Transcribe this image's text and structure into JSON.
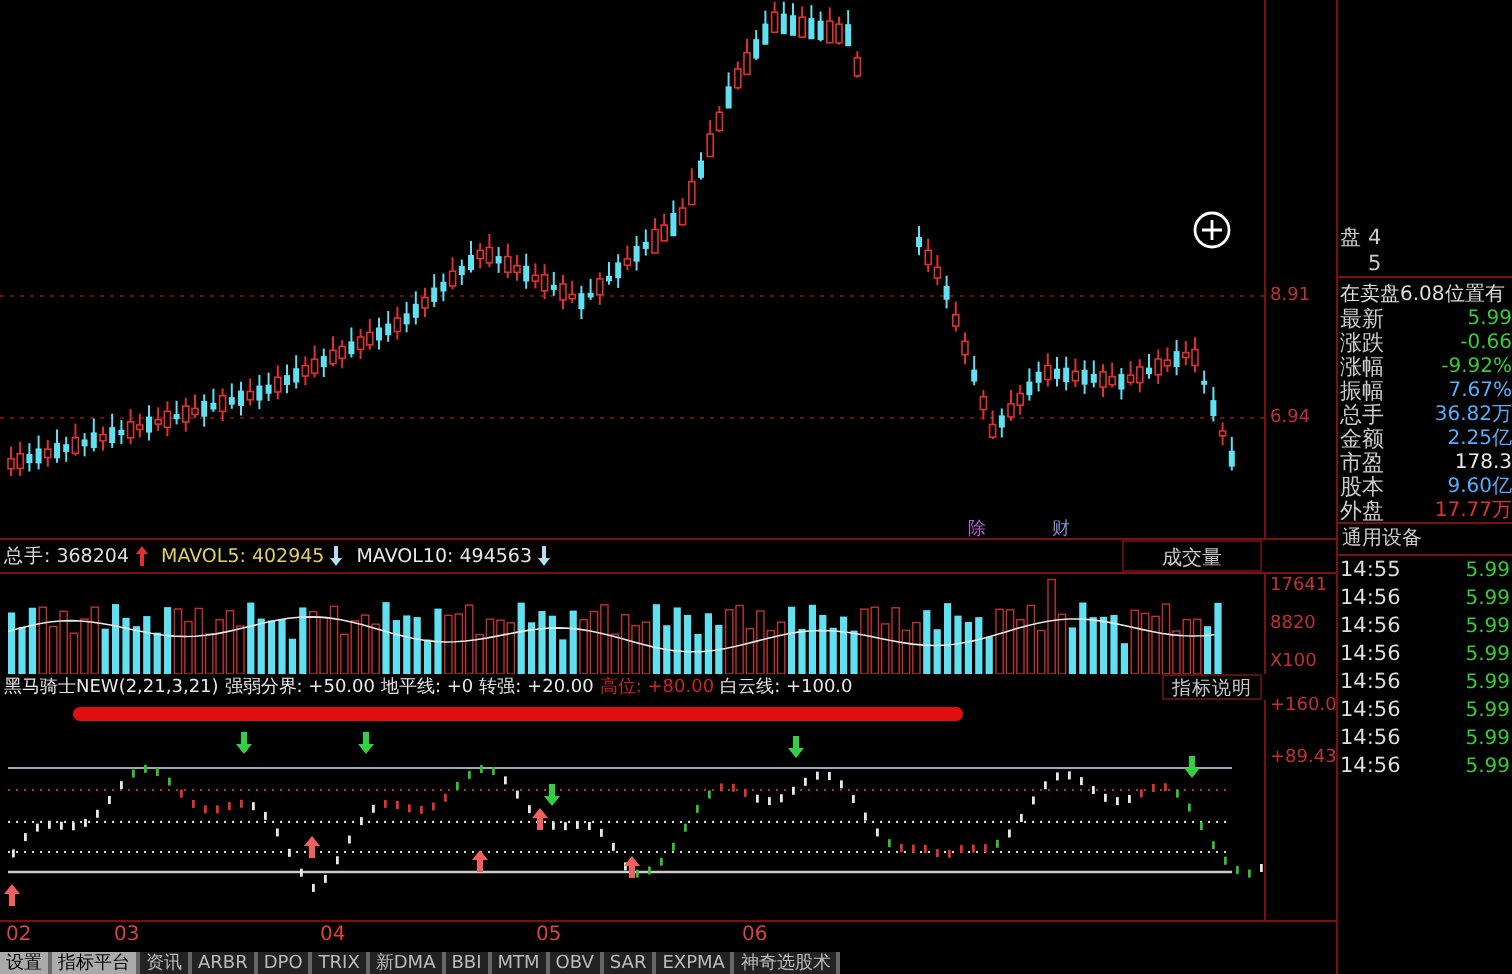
{
  "main_chart": {
    "axis_labels": [
      "8.91",
      "6.94"
    ],
    "event_marks": [
      "除",
      "财"
    ]
  },
  "volume_panel": {
    "legend": [
      {
        "label": "总手:",
        "value": "368204",
        "rising": true
      },
      {
        "label": "MAVOL5:",
        "value": "402945",
        "rising": false
      },
      {
        "label": "MAVOL10:",
        "value": "494563",
        "rising": false
      }
    ],
    "button": "成交量",
    "axis_labels": [
      "17641",
      "8820",
      "X100"
    ]
  },
  "indicator_panel": {
    "name": "黑马骑士NEW(2,21,3,21)",
    "params": [
      {
        "label": "强弱分界:",
        "value": "+50.00",
        "color": "#e8e8e8"
      },
      {
        "label": "地平线:",
        "value": "+0",
        "color": "#e8e8e8"
      },
      {
        "label": "转强:",
        "value": "+20.00",
        "color": "#e8e8e8"
      },
      {
        "label": "高位:",
        "value": "+80.00",
        "color": "#d02020"
      },
      {
        "label": "白云线:",
        "value": "+100.0",
        "color": "#e8e8e8"
      }
    ],
    "button": "指标说明",
    "axis_labels": [
      "+160.0",
      "+89.43"
    ]
  },
  "dates": [
    "02",
    "03",
    "04",
    "05",
    "06"
  ],
  "tabs": [
    {
      "label": "设置",
      "selected": true
    },
    {
      "label": "指标平台",
      "selected": true
    },
    {
      "label": "资讯",
      "selected": false
    },
    {
      "label": "ARBR",
      "selected": false
    },
    {
      "label": "DPO",
      "selected": false
    },
    {
      "label": "TRIX",
      "selected": false
    },
    {
      "label": "新DMA",
      "selected": false
    },
    {
      "label": "BBI",
      "selected": false
    },
    {
      "label": "MTM",
      "selected": false
    },
    {
      "label": "OBV",
      "selected": false
    },
    {
      "label": "SAR",
      "selected": false
    },
    {
      "label": "EXPMA",
      "selected": false
    },
    {
      "label": "神奇选股术",
      "selected": false
    }
  ],
  "quote_panel": {
    "order_rows": [
      {
        "label": "盘",
        "level": "4"
      },
      {
        "label": "",
        "level": "5"
      }
    ],
    "notice": "在卖盘6.08位置有",
    "stats": [
      {
        "label": "最新",
        "value": "5.99",
        "color": "#30d030"
      },
      {
        "label": "涨跌",
        "value": "-0.66",
        "color": "#30d030"
      },
      {
        "label": "涨幅",
        "value": "-9.92%",
        "color": "#30d030"
      },
      {
        "label": "振幅",
        "value": "7.67%",
        "color": "#50b0ff"
      },
      {
        "label": "总手",
        "value": "36.82万",
        "color": "#50b0ff"
      },
      {
        "label": "金额",
        "value": "2.25亿",
        "color": "#50b0ff"
      },
      {
        "label": "市盈",
        "value": "178.3",
        "color": "#e8e8e8"
      },
      {
        "label": "股本",
        "value": "9.60亿",
        "color": "#50b0ff"
      },
      {
        "label": "外盘",
        "value": "17.77万",
        "color": "#e03030"
      }
    ],
    "industry": "通用设备",
    "ticks": [
      {
        "time": "14:55",
        "price": "5.99"
      },
      {
        "time": "14:56",
        "price": "5.99"
      },
      {
        "time": "14:56",
        "price": "5.99"
      },
      {
        "time": "14:56",
        "price": "5.99"
      },
      {
        "time": "14:56",
        "price": "5.99"
      },
      {
        "time": "14:56",
        "price": "5.99"
      },
      {
        "time": "14:56",
        "price": "5.99"
      },
      {
        "time": "14:56",
        "price": "5.99"
      }
    ]
  }
}
